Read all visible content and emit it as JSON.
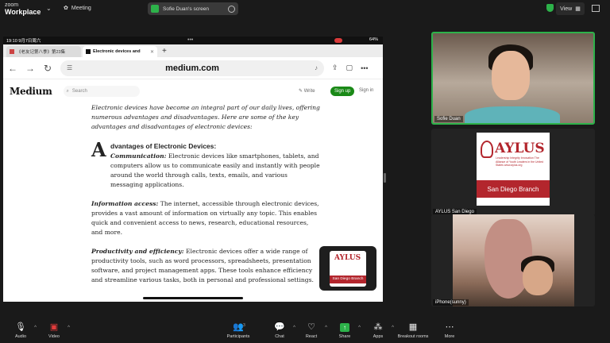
{
  "app": {
    "brand_top": "zoom",
    "brand_main": "Workplace",
    "meeting_label": "Meeting",
    "share_status": "Sofie Duan's screen",
    "view_label": "View"
  },
  "ipad": {
    "status_time": "19:10  9月7日周六",
    "status_right": "64%",
    "tabs": [
      {
        "label": "《老友记第八季》第23集",
        "active": false
      },
      {
        "label": "Electronic devices and",
        "active": true
      }
    ],
    "url": "medium.com",
    "site": {
      "logo": "Medium",
      "search_placeholder": "Search",
      "write": "Write",
      "signup": "Sign up",
      "signin": "Sign in"
    },
    "article": {
      "intro": "Electronic devices have become an integral part of our daily lives, offering numerous advantages and disadvantages. Here are some of the key advantages and disadvantages of electronic devices:",
      "dropcap": "A",
      "heading": "dvantages of Electronic Devices:",
      "p1_label": "Communication:",
      "p1_text": " Electronic devices like smartphones, tablets, and computers allow us to communicate easily and instantly with people around the world through calls, texts, emails, and various messaging applications.",
      "p2_label": "Information access:",
      "p2_text": " The internet, accessible through electronic devices, provides a vast amount of information on virtually any topic. This enables quick and convenient access to news, research, educational resources, and more.",
      "p3_label": "Productivity and efficiency:",
      "p3_text": " Electronic devices offer a wide range of productivity tools, such as word processors, spreadsheets, presentation software, and project management apps. These tools enhance efficiency and streamline various tasks, both in personal and professional settings."
    },
    "pip": {
      "logo": "AYLUS",
      "band": "San Diego Branch"
    }
  },
  "participants": [
    {
      "name": "Sofie Duan"
    },
    {
      "name": "AYLUS San Diego",
      "logo": "AYLUS",
      "subtitle": "Leadership Integrity Innovation The Alliance of Youth Leaders in the United States www.aylus.org",
      "band": "San Diego Branch"
    },
    {
      "name": "iPhone(sunny)"
    }
  ],
  "toolbar": {
    "audio": "Audio",
    "video": "Video",
    "participants": "Participants",
    "participants_count": "3",
    "chat": "Chat",
    "react": "React",
    "share": "Share",
    "apps": "Apps",
    "breakout": "Breakout rooms",
    "more": "More"
  }
}
